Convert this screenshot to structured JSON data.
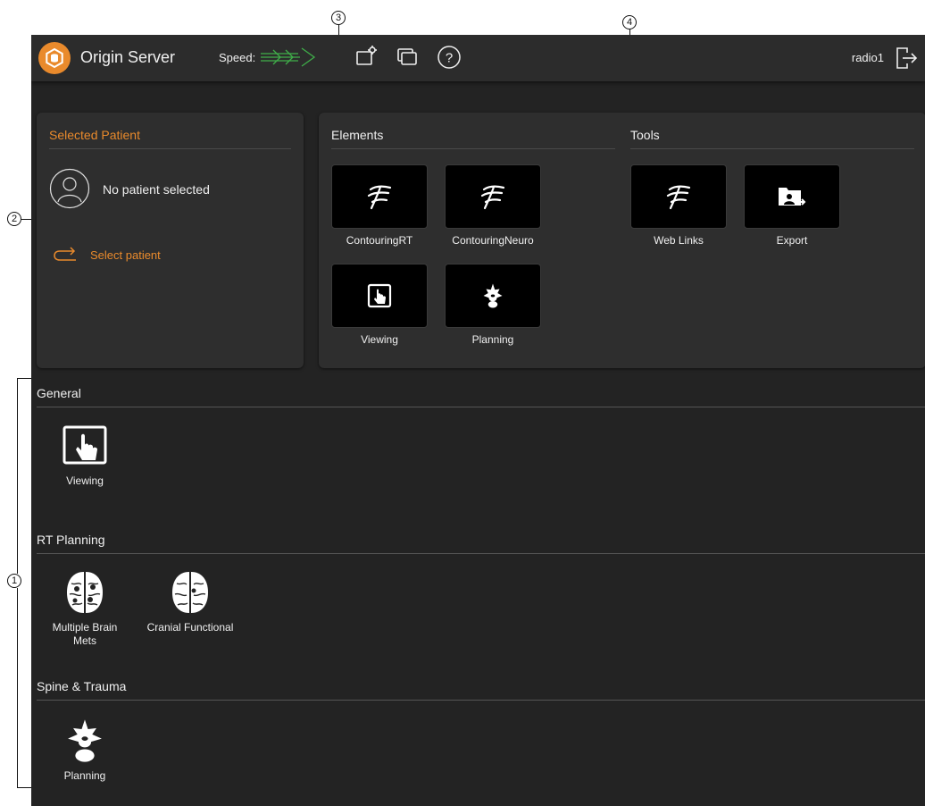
{
  "callouts": {
    "c1": "1",
    "c2": "2",
    "c3": "3",
    "c4": "4"
  },
  "header": {
    "title": "Origin Server",
    "speed_label": "Speed:",
    "user": "radio1"
  },
  "patient": {
    "heading": "Selected Patient",
    "status": "No patient selected",
    "select_label": "Select patient"
  },
  "elements": {
    "heading": "Elements",
    "items": [
      {
        "label": "ContouringRT",
        "icon": "contouring-icon"
      },
      {
        "label": "ContouringNeuro",
        "icon": "contouring-icon"
      },
      {
        "label": "Viewing",
        "icon": "viewing-icon"
      },
      {
        "label": "Planning",
        "icon": "spine-icon"
      }
    ]
  },
  "tools": {
    "heading": "Tools",
    "items": [
      {
        "label": "Web Links",
        "icon": "contouring-icon"
      },
      {
        "label": "Export",
        "icon": "export-icon"
      }
    ]
  },
  "sections": [
    {
      "title": "General",
      "items": [
        {
          "label": "Viewing",
          "icon": "viewing-icon"
        }
      ]
    },
    {
      "title": "RT Planning",
      "items": [
        {
          "label": "Multiple Brain Mets",
          "icon": "brain-icon"
        },
        {
          "label": "Cranial Functional",
          "icon": "brain-icon"
        }
      ]
    },
    {
      "title": "Spine & Trauma",
      "items": [
        {
          "label": "Planning",
          "icon": "spine-icon"
        }
      ]
    }
  ],
  "colors": {
    "accent": "#e98a2c",
    "background": "#232323",
    "panel": "#2e2e2e",
    "speed": "#3fae49"
  }
}
